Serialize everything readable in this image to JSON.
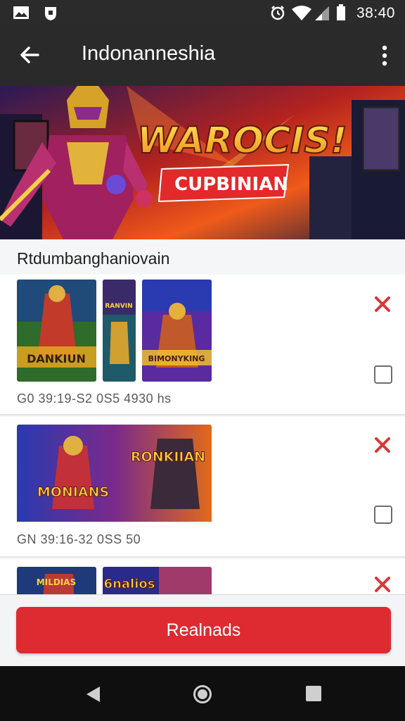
{
  "status_bar": {
    "time": "38:40",
    "icons": [
      "gallery-icon",
      "shield-icon",
      "alarm-icon",
      "wifi-icon",
      "signal-icon",
      "battery-icon"
    ]
  },
  "app_bar": {
    "title": "Indonanneshia"
  },
  "banner": {
    "headline": "WAROCIS!",
    "subtitle": "CUPBINIAN"
  },
  "section": {
    "title": "Rtdumbanghaniovain"
  },
  "items": [
    {
      "meta": "G0 39:19-S2  0S5 4930 hs",
      "thumbs": [
        {
          "caption": "DANKIUN"
        },
        {
          "caption": "RANVIN"
        },
        {
          "caption": "BIMONYKING"
        }
      ]
    },
    {
      "meta": "GN 39:16-32  0SS 50",
      "thumbs": [
        {
          "caption": "MONIANS"
        },
        {
          "caption": "RONKIIAN"
        }
      ]
    },
    {
      "meta": "",
      "thumbs": [
        {
          "caption": "MILDIAS"
        },
        {
          "caption": "6nalios"
        }
      ]
    }
  ],
  "footer": {
    "button_label": "Realnads"
  },
  "colors": {
    "accent": "#dd2b31",
    "app_bar": "#2a2a2a",
    "status_bar": "#2b2b2b",
    "nav_bar": "#0f0f0f"
  }
}
